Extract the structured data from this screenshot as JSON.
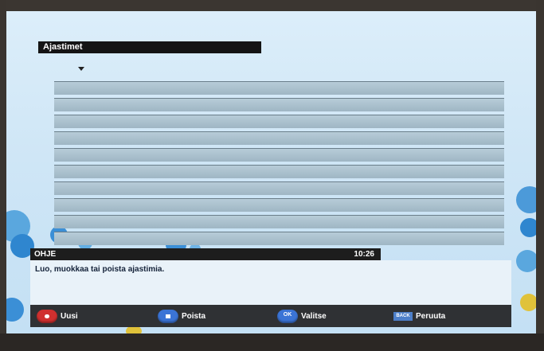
{
  "title": "Ajastimet",
  "timer_rows": [
    "",
    "",
    "",
    "",
    "",
    "",
    "",
    "",
    "",
    ""
  ],
  "help": {
    "label": "OHJE",
    "time": "10:26",
    "text": "Luo, muokkaa tai poista ajastimia."
  },
  "footer": {
    "new_label": "Uusi",
    "delete_label": "Poista",
    "select_label": "Valitse",
    "select_key": "OK",
    "cancel_label": "Peruuta",
    "cancel_key": "BACK"
  },
  "colors": {
    "red_key": "#d0302f",
    "blue_key": "#3b74d6",
    "background": "#cfe6f6",
    "row": "#a9bfcc"
  },
  "icons": [
    "down-arrow-icon",
    "red-button-icon",
    "blue-button-icon",
    "ok-button-icon",
    "back-button-icon"
  ]
}
